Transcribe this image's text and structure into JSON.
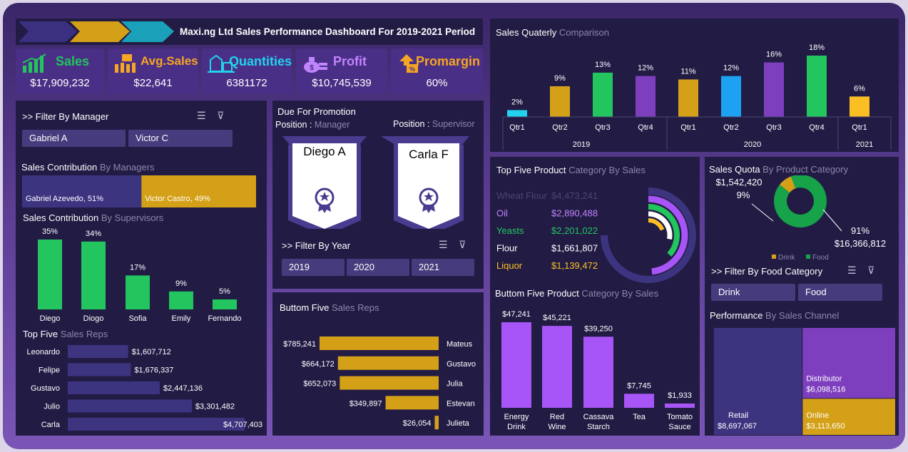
{
  "header": {
    "title": "Maxi.ng Ltd Sales Performance Dashboard For 2019-2021 Period",
    "arrows": [
      "#3b3080",
      "#d4a017",
      "#1aa0b8"
    ]
  },
  "kpis": [
    {
      "label": "Sales",
      "value": "$17,909,232",
      "color": "#22c55e",
      "icon": "bar-chart-icon"
    },
    {
      "label": "Avg.Sales",
      "value": "$22,641",
      "color": "#f5a623",
      "icon": "calculator-icon"
    },
    {
      "label": "Quantities",
      "value": "6381172",
      "color": "#22d3ee",
      "icon": "boxes-icon"
    },
    {
      "label": "Profit",
      "value": "$10,745,539",
      "color": "#c084fc",
      "icon": "money-bag-icon"
    },
    {
      "label": "Promargin",
      "value": "60%",
      "color": "#f5a623",
      "icon": "percent-arrow-icon"
    }
  ],
  "manager_filter": {
    "title": ">> Filter By Manager",
    "options": [
      "Gabriel A",
      "Victor C"
    ]
  },
  "promotion": {
    "title": "Due For Promotion",
    "manager_label": "Position :",
    "manager_role": "Manager",
    "supervisor_label": "Position :",
    "supervisor_role": "Supervisor",
    "manager_name": "Diego A",
    "supervisor_name": "Carla F"
  },
  "year_filter": {
    "title": ">> Filter By Year",
    "options": [
      "2019",
      "2020",
      "2021"
    ]
  },
  "food_filter": {
    "title": ">> Filter By Food Category",
    "options": [
      "Drink",
      "Food"
    ]
  },
  "sections": {
    "quarterly_title": "Sales Quaterly",
    "quarterly_sub": "Comparison",
    "managers_title": "Sales Contribution",
    "managers_sub": "By Managers",
    "supervisors_title": "Sales Contribution",
    "supervisors_sub": "By Supervisors",
    "top_reps_title": "Top Five",
    "top_reps_sub": "Sales Reps",
    "bottom_reps_title": "Buttom Five",
    "bottom_reps_sub": "Sales Reps",
    "top_products_title": "Top Five Product",
    "top_products_sub": "Category By Sales",
    "bottom_products_title": "Buttom Five Product",
    "bottom_products_sub": "Category By Sales",
    "quota_title": "Sales Quota",
    "quota_sub": "By Product Category",
    "channel_title": "Performance",
    "channel_sub": "By Sales Channel"
  },
  "chart_data": [
    {
      "id": "quarterly",
      "type": "bar",
      "categories": [
        "Qtr1",
        "Qtr2",
        "Qtr3",
        "Qtr4",
        "Qtr1",
        "Qtr2",
        "Qtr3",
        "Qtr4",
        "Qtr1"
      ],
      "years": [
        "2019",
        "2019",
        "2019",
        "2019",
        "2020",
        "2020",
        "2020",
        "2020",
        "2021"
      ],
      "year_groups": [
        "2019",
        "2020",
        "2021"
      ],
      "values": [
        2,
        9,
        13,
        12,
        11,
        12,
        16,
        18,
        6
      ],
      "labels": [
        "2%",
        "9%",
        "13%",
        "12%",
        "11%",
        "12%",
        "16%",
        "18%",
        "6%"
      ],
      "colors": [
        "#22d3ee",
        "#d4a017",
        "#22c55e",
        "#7e3fbf",
        "#d4a017",
        "#1da1f2",
        "#7e3fbf",
        "#22c55e",
        "#fbbf24"
      ]
    },
    {
      "id": "managers",
      "type": "bar",
      "categories": [
        "Gabriel Azevedo, 51%",
        "Victor Castro, 49%"
      ],
      "values": [
        51,
        49
      ],
      "colors": [
        "#3d3480",
        "#d4a017"
      ]
    },
    {
      "id": "supervisors",
      "type": "bar",
      "categories": [
        "Diego",
        "Diogo",
        "Sofia",
        "Emily",
        "Fernando"
      ],
      "values": [
        35,
        34,
        17,
        9,
        5
      ],
      "labels": [
        "35%",
        "34%",
        "17%",
        "9%",
        "5%"
      ],
      "color": "#22c55e"
    },
    {
      "id": "top_reps",
      "type": "bar",
      "categories": [
        "Leonardo",
        "Felipe",
        "Gustavo",
        "Julio",
        "Carla"
      ],
      "values": [
        1607712,
        1676337,
        2447136,
        3301482,
        4707403
      ],
      "labels": [
        "$1,607,712",
        "$1,676,337",
        "$2,447,136",
        "$3,301,482",
        "$4,707,403"
      ],
      "color": "#3d3480"
    },
    {
      "id": "bottom_reps",
      "type": "bar",
      "categories": [
        "Mateus",
        "Gustavo",
        "Julia",
        "Estevan",
        "Julieta"
      ],
      "values": [
        785241,
        664172,
        652073,
        349897,
        26054
      ],
      "labels": [
        "$785,241",
        "$664,172",
        "$652,073",
        "$349,897",
        "$26,054"
      ],
      "color": "#d4a017"
    },
    {
      "id": "top_products",
      "type": "pie",
      "categories": [
        "Wheat Flour",
        "Oil",
        "Yeasts",
        "Flour",
        "Liquor"
      ],
      "values": [
        4473241,
        2890488,
        2201022,
        1661807,
        1139472
      ],
      "labels": [
        "$4,473,241",
        "$2,890,488",
        "$2,201,022",
        "$1,661,807",
        "$1,139,472"
      ],
      "colors": [
        "#3d3480",
        "#a855f7",
        "#22c55e",
        "#ffffff",
        "#fbbf24"
      ]
    },
    {
      "id": "bottom_products",
      "type": "bar",
      "categories": [
        "Energy Drink",
        "Red Wine",
        "Cassava Starch",
        "Tea",
        "Tomato Sauce"
      ],
      "values": [
        47241,
        45221,
        39250,
        7745,
        1933
      ],
      "labels": [
        "$47,241",
        "$45,221",
        "$39,250",
        "$7,745",
        "$1,933"
      ],
      "color": "#a855f7"
    },
    {
      "id": "quota",
      "type": "pie",
      "categories": [
        "Drink",
        "Food"
      ],
      "values": [
        1542420,
        16366812
      ],
      "value_labels": [
        "$1,542,420",
        "$16,366,812"
      ],
      "percent_labels": [
        "9%",
        "91%"
      ],
      "colors": [
        "#d4a017",
        "#16a34a"
      ]
    },
    {
      "id": "channels",
      "type": "heatmap",
      "categories": [
        "Retail",
        "Distributor",
        "Online"
      ],
      "values": [
        8697067,
        6098516,
        3113650
      ],
      "labels": [
        "$8,697,067",
        "$6,098,516",
        "$3,113,650"
      ],
      "colors": [
        "#3d3480",
        "#7e3fbf",
        "#d4a017"
      ]
    }
  ]
}
